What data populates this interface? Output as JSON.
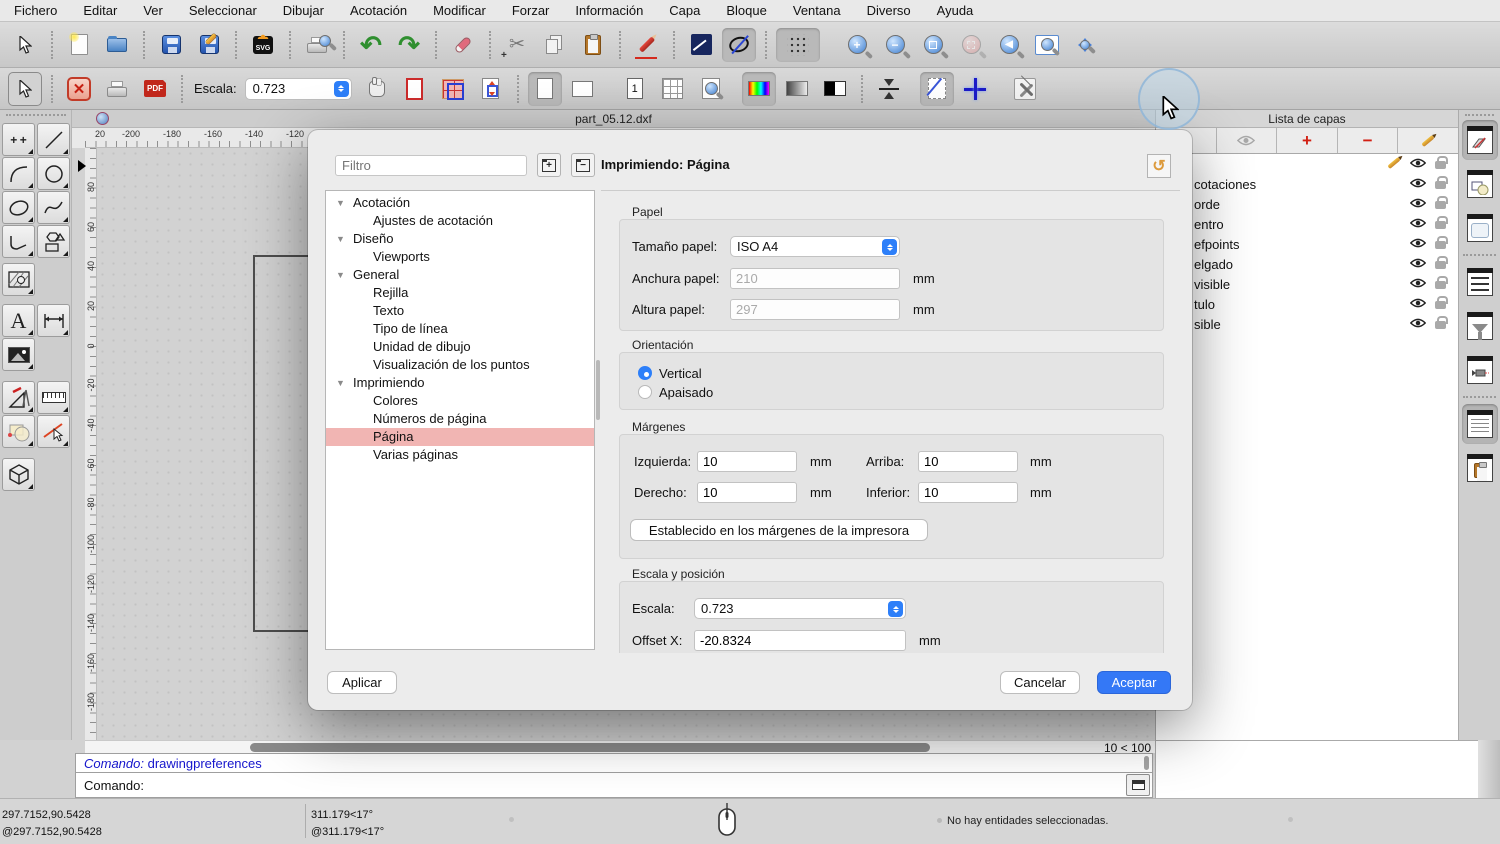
{
  "colors": {
    "accent_blue": "#2d7ff9",
    "tree_selection_pink": "#f1b5b3",
    "ok_button_blue": "#3478f6",
    "canvas_gray": "#d2d2d2"
  },
  "menu_bar": {
    "items": [
      "Fichero",
      "Editar",
      "Ver",
      "Seleccionar",
      "Dibujar",
      "Acotación",
      "Modificar",
      "Forzar",
      "Información",
      "Capa",
      "Bloque",
      "Ventana",
      "Diverso",
      "Ayuda"
    ]
  },
  "toolbar_top": {
    "icons": [
      "selection-cursor",
      "new-document",
      "open-document",
      "save",
      "save-as",
      "svg-export",
      "print-preview",
      "undo",
      "redo",
      "eraser",
      "cut",
      "copy",
      "paste",
      "draw-pencil",
      "line-tool",
      "ellipse-tool",
      "grid-snap",
      "zoom-in",
      "zoom-out",
      "zoom-auto",
      "zoom-selection",
      "zoom-previous",
      "zoom-window",
      "zoom-pan"
    ],
    "svg_label": "SVG",
    "undo_glyph": "↶",
    "redo_glyph": "↷",
    "zoom_in_glyph": "+",
    "zoom_out_glyph": "−"
  },
  "print_toolbar": {
    "icons": [
      "selection-cursor",
      "close-print-preview",
      "print",
      "export-pdf",
      "pan-hand",
      "paper-border",
      "tiled-pages",
      "fit-to-page",
      "portrait",
      "landscape",
      "single-page",
      "multi-page-grid",
      "zoom-page",
      "color-mode",
      "grayscale-mode",
      "blackwhite-mode",
      "center-vertically",
      "draft-mode",
      "crosshair",
      "drawing-preferences"
    ],
    "scale_label": "Escala:",
    "scale_value": "0.723",
    "pdf_label": "PDF",
    "page_one_label": "1",
    "close_glyph": "✕"
  },
  "left_toolbar": {
    "icons": [
      "points",
      "line",
      "arc",
      "circle",
      "ellipse",
      "spline",
      "polyline",
      "polygon-shapes",
      "hatch",
      "text",
      "dimension",
      "image",
      "drafting-tools",
      "measure-ruler",
      "modify-shapes",
      "trim",
      "solid-3d"
    ]
  },
  "document": {
    "tab_title": "part_05.12.dxf",
    "h_ruler_ticks": [
      "20",
      "-200",
      "-180",
      "-160",
      "-140",
      "-120"
    ],
    "v_ruler_ticks": [
      "80",
      "60",
      "40",
      "20",
      "0",
      "-20",
      "-40",
      "-60",
      "-80",
      "-100",
      "-120",
      "-140",
      "-160",
      "-180"
    ]
  },
  "dialog": {
    "filter_placeholder": "Filtro",
    "title": "Imprimiendo: Página",
    "tree": {
      "items": [
        {
          "label": "Acotación",
          "level": 0
        },
        {
          "label": "Ajustes de acotación",
          "level": 1
        },
        {
          "label": "Diseño",
          "level": 0
        },
        {
          "label": "Viewports",
          "level": 1
        },
        {
          "label": "General",
          "level": 0
        },
        {
          "label": "Rejilla",
          "level": 1
        },
        {
          "label": "Texto",
          "level": 1
        },
        {
          "label": "Tipo de línea",
          "level": 1
        },
        {
          "label": "Unidad de dibujo",
          "level": 1
        },
        {
          "label": "Visualización de los puntos",
          "level": 1
        },
        {
          "label": "Imprimiendo",
          "level": 0
        },
        {
          "label": "Colores",
          "level": 1
        },
        {
          "label": "Números de página",
          "level": 1
        },
        {
          "label": "Página",
          "level": 1,
          "selected": true
        },
        {
          "label": "Varias páginas",
          "level": 1
        }
      ]
    },
    "paper": {
      "group_label": "Papel",
      "size_label": "Tamaño papel:",
      "size_value": "ISO A4",
      "width_label": "Anchura papel:",
      "width_value": "210",
      "height_label": "Altura papel:",
      "height_value": "297",
      "unit": "mm"
    },
    "orientation": {
      "group_label": "Orientación",
      "vertical_label": "Vertical",
      "landscape_label": "Apaisado",
      "selected": "Vertical"
    },
    "margins": {
      "group_label": "Márgenes",
      "left_label": "Izquierda:",
      "left_value": "10",
      "top_label": "Arriba:",
      "top_value": "10",
      "right_label": "Derecho:",
      "right_value": "10",
      "bottom_label": "Inferior:",
      "bottom_value": "10",
      "unit": "mm",
      "printer_margins_button": "Establecido en los márgenes de la impresora"
    },
    "scale_position": {
      "group_label": "Escala y posición",
      "scale_label": "Escala:",
      "scale_value": "0.723",
      "offset_x_label": "Offset X:",
      "offset_x_value": "-20.8324",
      "unit": "mm"
    },
    "buttons": {
      "apply": "Aplicar",
      "cancel": "Cancelar",
      "ok": "Aceptar"
    },
    "reset_glyph": "↺"
  },
  "layer_panel": {
    "title": "Lista de capas",
    "toolbar_icons": [
      "hidden-under-dialog",
      "toggle-visibility-eye",
      "add-layer",
      "remove-layer",
      "edit-layer"
    ],
    "add_glyph": "+",
    "remove_glyph": "−",
    "rows": [
      {
        "name": ""
      },
      {
        "name": "cotaciones"
      },
      {
        "name": "orde"
      },
      {
        "name": "entro"
      },
      {
        "name": "efpoints"
      },
      {
        "name": "elgado"
      },
      {
        "name": "visible"
      },
      {
        "name": "tulo"
      },
      {
        "name": "sible"
      }
    ]
  },
  "right_dock": {
    "icons": [
      "layer-list",
      "block-list",
      "library-browser",
      "entity-list",
      "filter",
      "pen-settings",
      "command-window",
      "clipboard"
    ]
  },
  "command_area": {
    "scroll_label": "10 < 100",
    "history_prompt": "Comando:",
    "history_command": " drawingpreferences",
    "prompt_label": "Comando:",
    "input_value": ""
  },
  "status_bar": {
    "absolute_coordinates": "297.7152,90.5428",
    "relative_coordinates": "@297.7152,90.5428",
    "absolute_polar": "311.179<17°",
    "relative_polar": "@311.179<17°",
    "selection_status": "No hay entidades seleccionadas."
  }
}
